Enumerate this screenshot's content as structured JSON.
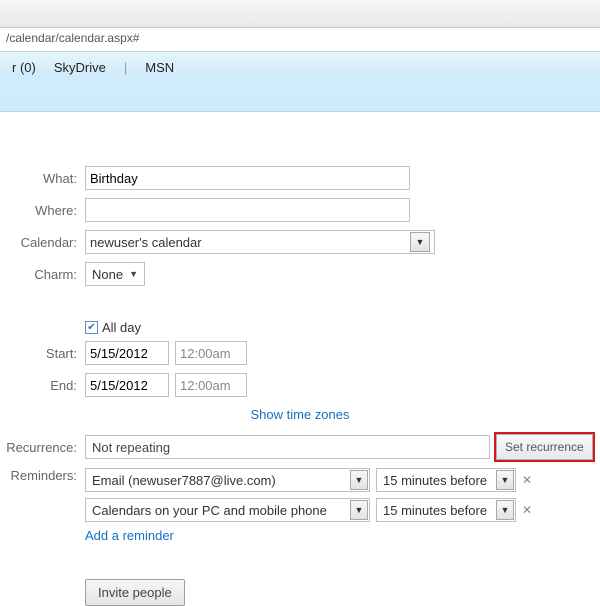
{
  "browser": {
    "url_fragment": "/calendar/calendar.aspx#"
  },
  "topnav": {
    "item1": "r (0)",
    "item2": "SkyDrive",
    "item3": "MSN"
  },
  "form": {
    "what_label": "What:",
    "what_value": "Birthday",
    "where_label": "Where:",
    "where_value": "",
    "calendar_label": "Calendar:",
    "calendar_value": "newuser's calendar",
    "charm_label": "Charm:",
    "charm_value": "None",
    "allday_label": "All day",
    "allday_checked": "✔",
    "start_label": "Start:",
    "start_date": "5/15/2012",
    "start_time": "12:00am",
    "end_label": "End:",
    "end_date": "5/15/2012",
    "end_time": "12:00am",
    "show_timezones": "Show time zones",
    "recurrence_label": "Recurrence:",
    "recurrence_value": "Not repeating",
    "set_recurrence": "Set recurrence",
    "reminders_label": "Reminders:",
    "reminders": [
      {
        "target": "Email (newuser7887@live.com)",
        "timing": "15 minutes before"
      },
      {
        "target": "Calendars on your PC and mobile phone",
        "timing": "15 minutes before"
      }
    ],
    "add_reminder": "Add a reminder",
    "invite": "Invite people"
  }
}
